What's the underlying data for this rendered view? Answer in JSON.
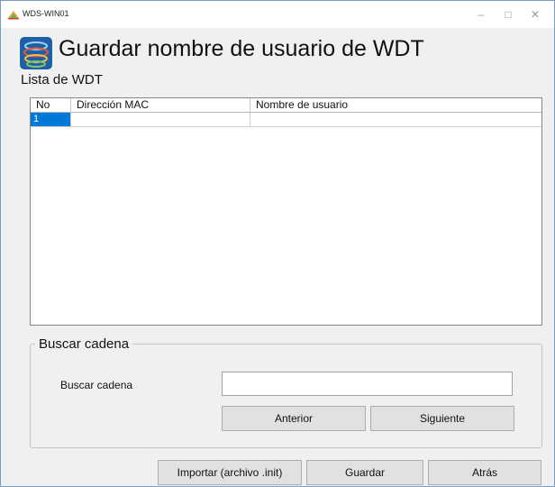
{
  "window": {
    "title": "WDS-WIN01",
    "min_glyph": "–",
    "max_glyph": "□",
    "close_glyph": "✕",
    "icon": "app-icon"
  },
  "header": {
    "title": "Guardar nombre de usuario de WDT",
    "icon": "wdt-logo-icon"
  },
  "list": {
    "label": "Lista de WDT",
    "columns": [
      "No",
      "Dirección MAC",
      "Nombre de usuario"
    ],
    "rows": [
      {
        "no": "1",
        "mac": "",
        "user": ""
      }
    ],
    "selection_color": "#0078d7"
  },
  "search": {
    "group_title": "Buscar cadena",
    "label": "Buscar cadena",
    "value": "",
    "prev_label": "Anterior",
    "next_label": "Siguiente"
  },
  "footer": {
    "import_label": "Importar (archivo .init)",
    "save_label": "Guardar",
    "back_label": "Atrás"
  }
}
